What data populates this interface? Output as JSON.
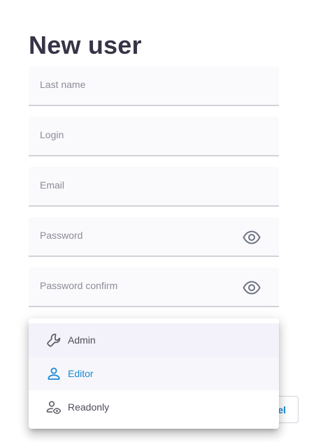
{
  "page": {
    "title": "New user"
  },
  "form": {
    "last_name_label": "Last name",
    "login_label": "Login",
    "email_label": "Email",
    "password_label": "Password",
    "password_confirm_label": "Password confirm"
  },
  "role_menu": {
    "items": [
      {
        "label": "Admin",
        "icon": "wrench-icon"
      },
      {
        "label": "Editor",
        "icon": "person-icon",
        "selected": true
      },
      {
        "label": "Readonly",
        "icon": "person-eye-icon"
      }
    ]
  },
  "actions": {
    "cancel_label_visible": "el"
  },
  "colors": {
    "accent": "#1a88d6",
    "title": "#363446",
    "field_bg": "#fafafc"
  }
}
